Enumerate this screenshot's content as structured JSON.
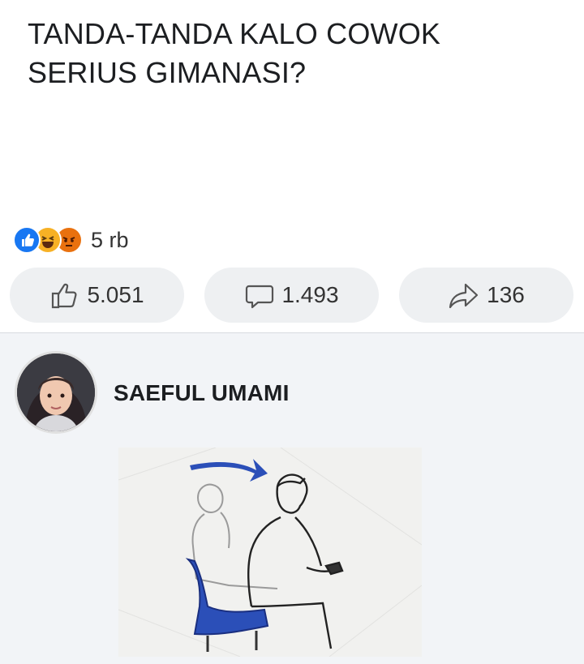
{
  "post": {
    "text_line1": "TANDA-TANDA KALO COWOK",
    "text_line2": "SERIUS GIMANASI?"
  },
  "reactions": {
    "types": [
      "like-icon",
      "haha-icon",
      "angry-icon"
    ],
    "count": "5 rb"
  },
  "actions": {
    "like_count": "5.051",
    "comment_count": "1.493",
    "share_count": "136"
  },
  "comment": {
    "author": "SAEFUL UMAMI",
    "image_description_icon": "illustration-man-leaning-forward"
  },
  "colors": {
    "like_blue": "#1877f2",
    "haha_yellow": "#f7b125",
    "angry_orange": "#e9710f",
    "button_bg": "#eef0f2",
    "comment_bg": "#f2f4f7",
    "arrow_blue": "#2b4fb8"
  }
}
